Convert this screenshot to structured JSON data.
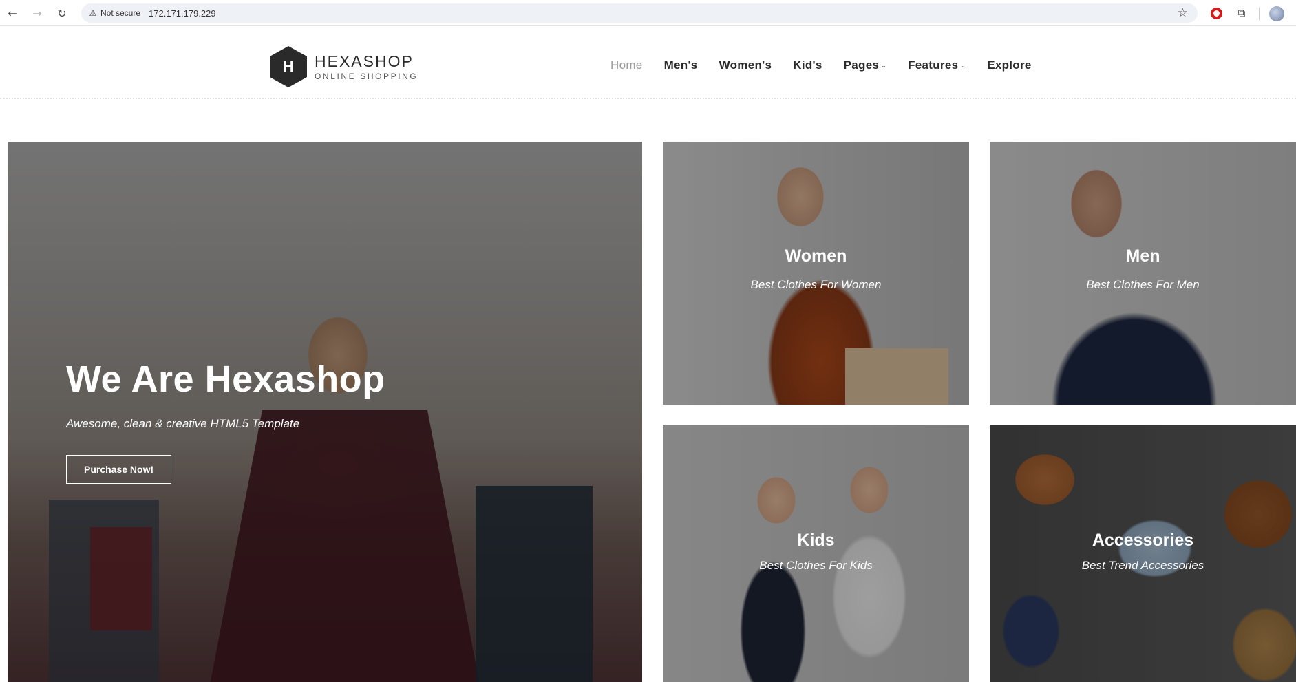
{
  "browser": {
    "security_label": "Not secure",
    "url": "172.171.179.229"
  },
  "site": {
    "logo_letter": "H",
    "logo_title": "HEXASHOP",
    "logo_subtitle": "ONLINE SHOPPING"
  },
  "menu": {
    "items": [
      {
        "label": "Home"
      },
      {
        "label": "Men's"
      },
      {
        "label": "Women's"
      },
      {
        "label": "Kid's"
      },
      {
        "label": "Pages"
      },
      {
        "label": "Features"
      },
      {
        "label": "Explore"
      }
    ]
  },
  "hero": {
    "title": "We Are Hexashop",
    "subtitle": "Awesome, clean & creative HTML5 Template",
    "button_label": "Purchase Now!"
  },
  "categories": [
    {
      "title": "Women",
      "subtitle": "Best Clothes For Women"
    },
    {
      "title": "Men",
      "subtitle": "Best Clothes For Men"
    },
    {
      "title": "Kids",
      "subtitle": "Best Clothes For Kids"
    },
    {
      "title": "Accessories",
      "subtitle": "Best Trend Accessories"
    }
  ]
}
